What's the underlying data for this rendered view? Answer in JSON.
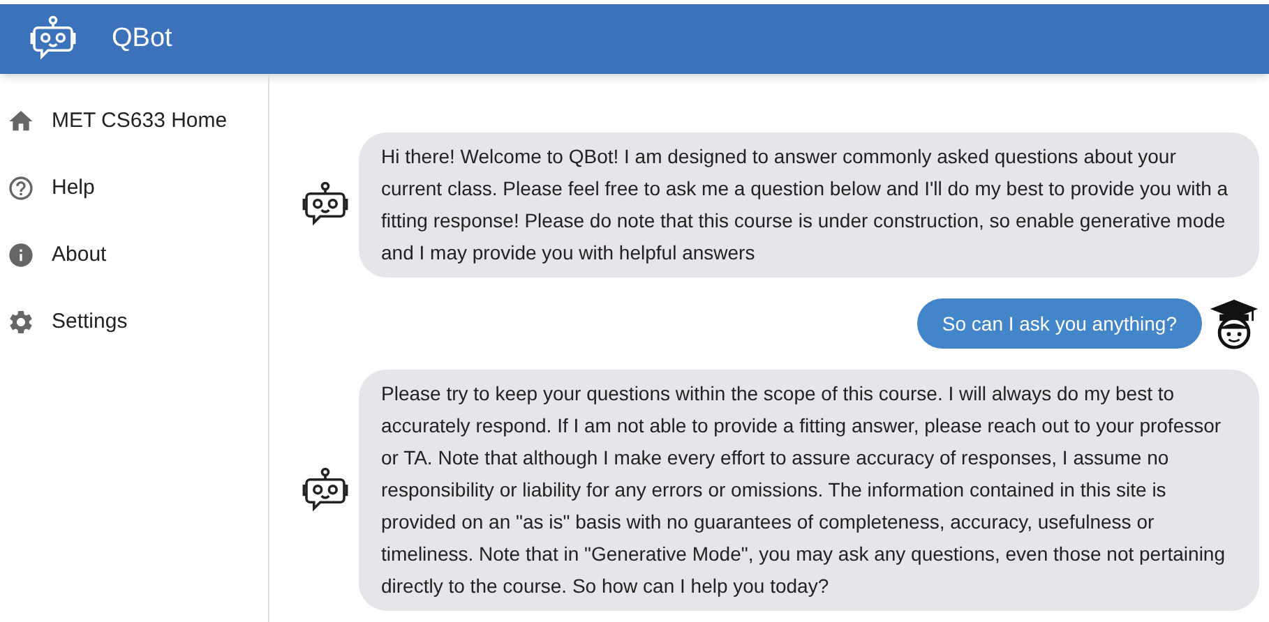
{
  "header": {
    "title": "QBot"
  },
  "sidebar": {
    "items": [
      {
        "label": "MET CS633 Home"
      },
      {
        "label": "Help"
      },
      {
        "label": "About"
      },
      {
        "label": "Settings"
      }
    ]
  },
  "messages": [
    {
      "kind": "bot",
      "text": "Hi there! Welcome to QBot! I am designed to answer commonly asked questions about your current class. Please feel free to ask me a question below and I'll do my best to provide you with a fitting response! Please do note that this course is under construction, so enable generative mode and I may provide you with helpful answers"
    },
    {
      "kind": "user",
      "text": "So can I ask you anything?"
    },
    {
      "kind": "bot",
      "text": "Please try to keep your questions within the scope of this course. I will always do my best to accurately respond. If I am not able to provide a fitting answer, please reach out to your professor or TA. Note that although I make every effort to assure accuracy of responses, I assume no responsibility or liability for any errors or omissions. The information contained in this site is provided on an \"as is\" basis with no guarantees of completeness, accuracy, usefulness or timeliness. Note that in \"Generative Mode\", you may ask any questions, even those not pertaining directly to the course. So how can I help you today?"
    }
  ]
}
